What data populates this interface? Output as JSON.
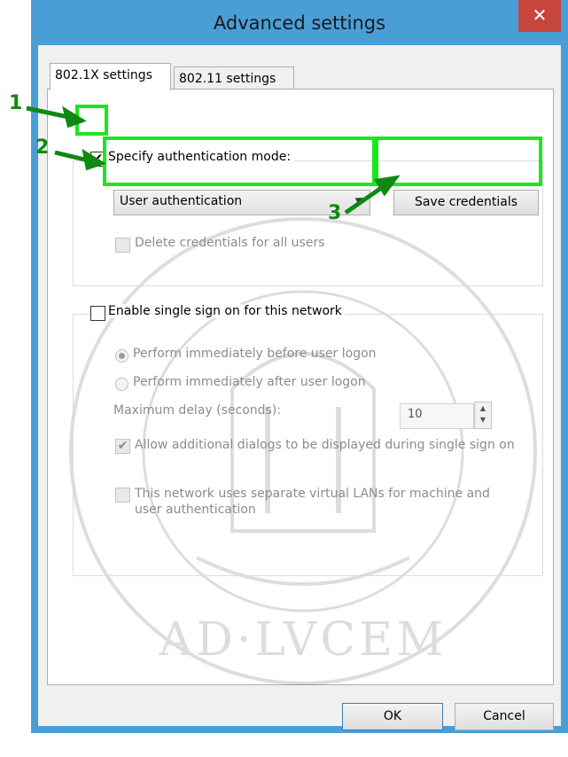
{
  "window": {
    "title": "Advanced settings",
    "close_glyph": "✕"
  },
  "tabs": [
    {
      "label": "802.1X settings",
      "active": true
    },
    {
      "label": "802.11 settings",
      "active": false
    }
  ],
  "auth": {
    "specify_label": "Specify authentication mode:",
    "specify_checked": true,
    "mode_selected": "User authentication",
    "save_credentials_label": "Save credentials",
    "delete_credentials_label": "Delete credentials for all users",
    "delete_checked": false
  },
  "sso": {
    "enable_label": "Enable single sign on for this network",
    "enable_checked": false,
    "before_logon_label": "Perform immediately before user logon",
    "before_logon_selected": true,
    "after_logon_label": "Perform immediately after user logon",
    "max_delay_label": "Maximum delay (seconds):",
    "max_delay_value": "10",
    "allow_dialogs_label": "Allow additional dialogs to be displayed during single sign on",
    "allow_dialogs_checked": true,
    "vlan_label": "This network uses separate virtual LANs for machine and user authentication",
    "vlan_checked": false
  },
  "footer": {
    "ok_label": "OK",
    "cancel_label": "Cancel"
  },
  "annotations": {
    "step1": "1",
    "step2": "2",
    "step3": "3"
  },
  "watermark": {
    "motto": "AD·LVCEM"
  },
  "colors": {
    "titlebar": "#4a9ed6",
    "close": "#c7463c",
    "highlight": "#1ee61e",
    "annotation": "#0e8a10"
  },
  "icons": {
    "close": "close-icon",
    "dropdown": "chevron-down-icon",
    "spin_up": "spin-up-icon",
    "spin_down": "spin-down-icon",
    "check": "checkmark-icon"
  }
}
